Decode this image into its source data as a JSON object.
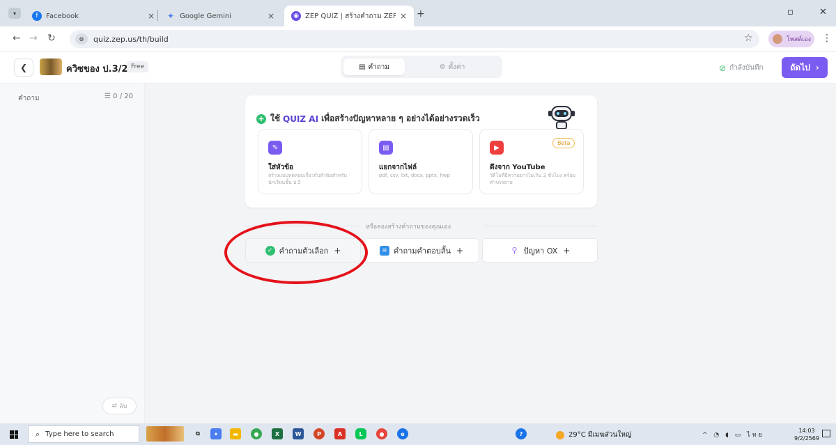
{
  "browser": {
    "tabs": [
      {
        "title": "Facebook",
        "icon": "facebook-icon",
        "color": "#1877f2"
      },
      {
        "title": "Google Gemini",
        "icon": "gemini-icon",
        "color": "#4a7df0"
      },
      {
        "title": "ZEP QUIZ | สร้างคำถาม ZEP QU",
        "icon": "zep-quiz-icon",
        "color": "#6a4de8"
      }
    ],
    "url": "quiz.zep.us/th/build",
    "profile_name": "โพสต์เอง"
  },
  "app": {
    "quiz_title": "ควิซของ ป.3/2",
    "plan_badge": "Free",
    "tabs": [
      {
        "label": "คำถาม",
        "icon": "document-icon",
        "active": true
      },
      {
        "label": "ตั้งค่า",
        "icon": "gear-icon",
        "active": false
      }
    ],
    "save_status": "กำลังบันทึก",
    "next_label": "ถัดไป",
    "accent": "#7b5cf0"
  },
  "sidebar": {
    "label": "คำถาม",
    "count": "0 / 20",
    "sort_label": "ลับ"
  },
  "ai_card": {
    "prefix": "ใช้",
    "brand": "QUIZ AI",
    "suffix": "เพื่อสร้างปัญหาหลาย ๆ อย่างได้อย่างรวดเร็ว",
    "options": [
      {
        "title": "ใส่หัวข้อ",
        "desc": "สร้างแบบทดสอบเกี่ยวกับหัวข้อสำหรับนักเรียนชั้น ป.5",
        "icon": "pencil-icon",
        "color": "#7b5cf0"
      },
      {
        "title": "แยกจากไฟล์",
        "desc": "pdf, csv, txt, docx, pptx, hwp",
        "icon": "file-icon",
        "color": "#7b5cf0"
      },
      {
        "title": "ดึงจาก YouTube",
        "desc": "วิดีโอที่มีความยาวไม่เกิน 2 ชั่วโมง พร้อมคำบรรยาย",
        "icon": "youtube-icon",
        "color": "#ee3e3e",
        "badge": "Beta"
      }
    ]
  },
  "manual": {
    "divider_text": "หรือลองสร้างคำถามของคุณเอง",
    "buttons": [
      {
        "label": "คำถามตัวเลือก",
        "icon": "check-circle-icon",
        "color": "#2fbf71"
      },
      {
        "label": "คำถามคำตอบสั้น",
        "icon": "chat-icon",
        "color": "#2f8fe8"
      },
      {
        "label": "ปัญหา OX",
        "icon": "ox-icon",
        "color": "#9b6cf5"
      }
    ],
    "plus": "+"
  },
  "taskbar": {
    "search_placeholder": "Type here to search",
    "weather": "29°C มีเมฆส่วนใหญ่",
    "lang": "ไทย",
    "time": "14:03",
    "date": "9/2/2569"
  }
}
